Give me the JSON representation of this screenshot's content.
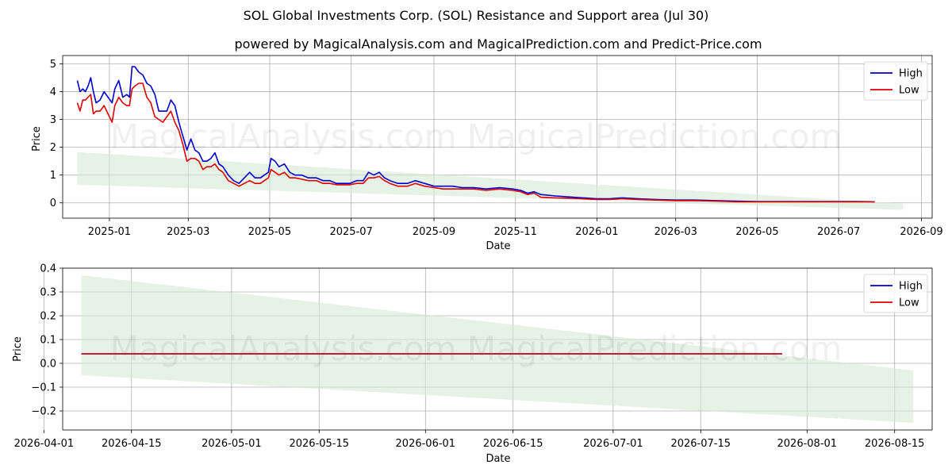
{
  "title": "SOL Global Investments Corp. (SOL) Resistance and Support area (Jul 30)",
  "subtitle": "powered by MagicalAnalysis.com and MagicalPrediction.com and Predict-Price.com",
  "watermark": "MagicalAnalysis.com    MagicalPrediction.com",
  "colors": {
    "high": "#0000cc",
    "low": "#dd0000",
    "band": "#d6ead3"
  },
  "chart_data": [
    {
      "type": "line",
      "xlabel": "Date",
      "ylabel": "Price",
      "x_range": [
        "2024-11-27",
        "2026-09-09"
      ],
      "ylim": [
        -0.55,
        5.3
      ],
      "x_ticks": [
        "2025-01",
        "2025-03",
        "2025-05",
        "2025-07",
        "2025-09",
        "2025-11",
        "2026-01",
        "2026-03",
        "2026-05",
        "2026-07",
        "2026-09"
      ],
      "x_tick_dates": [
        "2025-01-01",
        "2025-03-01",
        "2025-05-01",
        "2025-07-01",
        "2025-09-01",
        "2025-11-01",
        "2026-01-01",
        "2026-03-01",
        "2026-05-01",
        "2026-07-01",
        "2026-09-01"
      ],
      "y_ticks": [
        0,
        1,
        2,
        3,
        4,
        5
      ],
      "grid": true,
      "legend": "top-right",
      "band": {
        "start": "2024-12-08",
        "end": "2026-08-18",
        "start_upper": 1.83,
        "start_lower": 0.65,
        "end_upper": -0.03,
        "end_lower": -0.25
      },
      "series": [
        {
          "name": "High",
          "x": [
            "2024-12-08",
            "2024-12-10",
            "2024-12-12",
            "2024-12-14",
            "2024-12-16",
            "2024-12-18",
            "2024-12-20",
            "2024-12-22",
            "2024-12-25",
            "2024-12-28",
            "2024-12-31",
            "2025-01-03",
            "2025-01-05",
            "2025-01-08",
            "2025-01-11",
            "2025-01-14",
            "2025-01-16",
            "2025-01-18",
            "2025-01-20",
            "2025-01-23",
            "2025-01-26",
            "2025-01-29",
            "2025-02-01",
            "2025-02-04",
            "2025-02-07",
            "2025-02-10",
            "2025-02-13",
            "2025-02-16",
            "2025-02-19",
            "2025-02-22",
            "2025-02-25",
            "2025-02-28",
            "2025-03-03",
            "2025-03-06",
            "2025-03-09",
            "2025-03-12",
            "2025-03-15",
            "2025-03-18",
            "2025-03-21",
            "2025-03-24",
            "2025-03-27",
            "2025-03-31",
            "2025-04-04",
            "2025-04-08",
            "2025-04-12",
            "2025-04-16",
            "2025-04-20",
            "2025-04-24",
            "2025-04-27",
            "2025-04-30",
            "2025-05-02",
            "2025-05-05",
            "2025-05-08",
            "2025-05-12",
            "2025-05-16",
            "2025-05-20",
            "2025-05-25",
            "2025-05-30",
            "2025-06-05",
            "2025-06-10",
            "2025-06-15",
            "2025-06-20",
            "2025-06-25",
            "2025-06-30",
            "2025-07-05",
            "2025-07-10",
            "2025-07-14",
            "2025-07-18",
            "2025-07-22",
            "2025-07-26",
            "2025-07-30",
            "2025-08-05",
            "2025-08-12",
            "2025-08-18",
            "2025-08-25",
            "2025-09-01",
            "2025-09-08",
            "2025-09-15",
            "2025-09-22",
            "2025-10-01",
            "2025-10-10",
            "2025-10-20",
            "2025-10-30",
            "2025-11-05",
            "2025-11-10",
            "2025-11-15",
            "2025-11-20",
            "2025-12-01",
            "2025-12-15",
            "2026-01-01",
            "2026-01-10",
            "2026-01-20",
            "2026-02-01",
            "2026-02-15",
            "2026-03-01",
            "2026-03-15",
            "2026-04-01",
            "2026-04-15",
            "2026-05-01",
            "2026-05-15",
            "2026-06-01",
            "2026-06-15",
            "2026-07-01",
            "2026-07-15",
            "2026-07-28"
          ],
          "values": [
            4.4,
            4.0,
            4.1,
            4.0,
            4.2,
            4.5,
            4.0,
            3.6,
            3.7,
            4.0,
            3.8,
            3.6,
            4.1,
            4.4,
            3.8,
            3.9,
            3.8,
            4.9,
            4.9,
            4.7,
            4.6,
            4.3,
            4.2,
            3.9,
            3.3,
            3.3,
            3.3,
            3.7,
            3.5,
            2.9,
            2.4,
            1.9,
            2.3,
            1.9,
            1.8,
            1.5,
            1.5,
            1.6,
            1.8,
            1.4,
            1.3,
            1.0,
            0.8,
            0.7,
            0.9,
            1.1,
            0.9,
            0.9,
            1.0,
            1.1,
            1.6,
            1.5,
            1.3,
            1.4,
            1.1,
            1.0,
            1.0,
            0.9,
            0.9,
            0.8,
            0.8,
            0.7,
            0.7,
            0.7,
            0.8,
            0.8,
            1.1,
            1.0,
            1.1,
            0.9,
            0.8,
            0.7,
            0.7,
            0.8,
            0.7,
            0.6,
            0.6,
            0.6,
            0.55,
            0.55,
            0.5,
            0.55,
            0.5,
            0.45,
            0.35,
            0.4,
            0.3,
            0.25,
            0.2,
            0.15,
            0.15,
            0.18,
            0.15,
            0.12,
            0.1,
            0.1,
            0.08,
            0.06,
            0.05,
            0.05,
            0.05,
            0.045,
            0.045,
            0.045,
            0.04
          ]
        },
        {
          "name": "Low",
          "x": [
            "2024-12-08",
            "2024-12-10",
            "2024-12-12",
            "2024-12-14",
            "2024-12-16",
            "2024-12-18",
            "2024-12-20",
            "2024-12-22",
            "2024-12-25",
            "2024-12-28",
            "2024-12-31",
            "2025-01-03",
            "2025-01-05",
            "2025-01-08",
            "2025-01-11",
            "2025-01-14",
            "2025-01-16",
            "2025-01-18",
            "2025-01-20",
            "2025-01-23",
            "2025-01-26",
            "2025-01-29",
            "2025-02-01",
            "2025-02-04",
            "2025-02-07",
            "2025-02-10",
            "2025-02-13",
            "2025-02-16",
            "2025-02-19",
            "2025-02-22",
            "2025-02-25",
            "2025-02-28",
            "2025-03-03",
            "2025-03-06",
            "2025-03-09",
            "2025-03-12",
            "2025-03-15",
            "2025-03-18",
            "2025-03-21",
            "2025-03-24",
            "2025-03-27",
            "2025-03-31",
            "2025-04-04",
            "2025-04-08",
            "2025-04-12",
            "2025-04-16",
            "2025-04-20",
            "2025-04-24",
            "2025-04-27",
            "2025-04-30",
            "2025-05-02",
            "2025-05-05",
            "2025-05-08",
            "2025-05-12",
            "2025-05-16",
            "2025-05-20",
            "2025-05-25",
            "2025-05-30",
            "2025-06-05",
            "2025-06-10",
            "2025-06-15",
            "2025-06-20",
            "2025-06-25",
            "2025-06-30",
            "2025-07-05",
            "2025-07-10",
            "2025-07-14",
            "2025-07-18",
            "2025-07-22",
            "2025-07-26",
            "2025-07-30",
            "2025-08-05",
            "2025-08-12",
            "2025-08-18",
            "2025-08-25",
            "2025-09-01",
            "2025-09-08",
            "2025-09-15",
            "2025-09-22",
            "2025-10-01",
            "2025-10-10",
            "2025-10-20",
            "2025-10-30",
            "2025-11-05",
            "2025-11-10",
            "2025-11-15",
            "2025-11-20",
            "2025-12-01",
            "2025-12-15",
            "2026-01-01",
            "2026-01-10",
            "2026-01-20",
            "2026-02-01",
            "2026-02-15",
            "2026-03-01",
            "2026-03-15",
            "2026-04-01",
            "2026-04-15",
            "2026-05-01",
            "2026-05-15",
            "2026-06-01",
            "2026-06-15",
            "2026-07-01",
            "2026-07-15",
            "2026-07-28"
          ],
          "values": [
            3.6,
            3.3,
            3.7,
            3.7,
            3.8,
            3.9,
            3.2,
            3.3,
            3.3,
            3.5,
            3.2,
            2.9,
            3.5,
            3.8,
            3.6,
            3.5,
            3.5,
            4.1,
            4.2,
            4.3,
            4.3,
            3.8,
            3.6,
            3.1,
            3.0,
            2.9,
            3.1,
            3.3,
            2.9,
            2.6,
            2.1,
            1.5,
            1.6,
            1.6,
            1.5,
            1.2,
            1.3,
            1.3,
            1.4,
            1.2,
            1.1,
            0.8,
            0.7,
            0.6,
            0.7,
            0.8,
            0.7,
            0.7,
            0.8,
            0.9,
            1.2,
            1.1,
            1.0,
            1.1,
            0.9,
            0.9,
            0.85,
            0.8,
            0.8,
            0.7,
            0.7,
            0.65,
            0.65,
            0.65,
            0.7,
            0.7,
            0.9,
            0.9,
            0.95,
            0.8,
            0.7,
            0.6,
            0.6,
            0.7,
            0.6,
            0.55,
            0.5,
            0.5,
            0.5,
            0.5,
            0.45,
            0.5,
            0.45,
            0.4,
            0.3,
            0.35,
            0.2,
            0.18,
            0.16,
            0.12,
            0.12,
            0.15,
            0.12,
            0.1,
            0.08,
            0.08,
            0.06,
            0.04,
            0.04,
            0.04,
            0.04,
            0.04,
            0.04,
            0.04,
            0.04
          ]
        }
      ]
    },
    {
      "type": "line",
      "xlabel": "Date",
      "ylabel": "Price",
      "x_range": [
        "2026-04-04",
        "2026-08-21"
      ],
      "ylim": [
        -0.28,
        0.4
      ],
      "x_ticks": [
        "2026-04-01",
        "2026-04-15",
        "2026-05-01",
        "2026-05-15",
        "2026-06-01",
        "2026-06-15",
        "2026-07-01",
        "2026-07-15",
        "2026-08-01",
        "2026-08-15"
      ],
      "y_ticks": [
        -0.2,
        -0.1,
        0.0,
        0.1,
        0.2,
        0.3,
        0.4
      ],
      "y_tick_labels": [
        "−0.2",
        "−0.1",
        "0.0",
        "0.1",
        "0.2",
        "0.3",
        "0.4"
      ],
      "grid": true,
      "legend": "top-right",
      "band": {
        "start": "2026-04-07",
        "end": "2026-08-18",
        "start_upper": 0.37,
        "start_lower": -0.05,
        "end_upper": -0.03,
        "end_lower": -0.25
      },
      "series": [
        {
          "name": "High",
          "x": [
            "2026-04-07",
            "2026-07-28"
          ],
          "values": [
            0.04,
            0.04
          ]
        },
        {
          "name": "Low",
          "x": [
            "2026-04-07",
            "2026-07-28"
          ],
          "values": [
            0.04,
            0.04
          ]
        }
      ]
    }
  ]
}
